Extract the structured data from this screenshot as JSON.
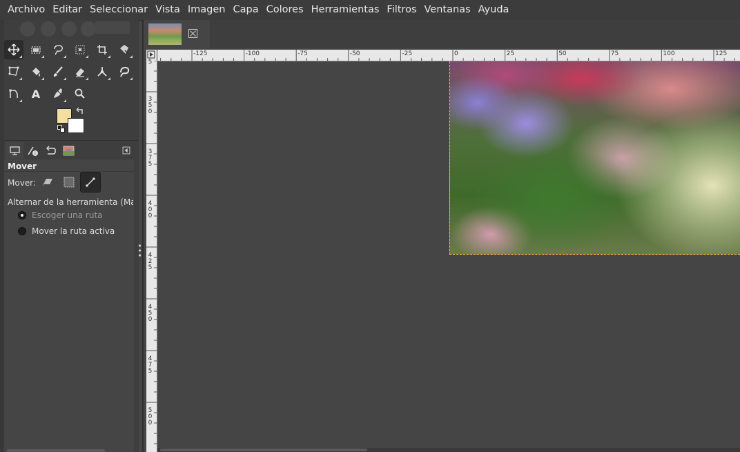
{
  "menu": [
    "Archivo",
    "Editar",
    "Seleccionar",
    "Vista",
    "Imagen",
    "Capa",
    "Colores",
    "Herramientas",
    "Filtros",
    "Ventanas",
    "Ayuda"
  ],
  "toolbox": {
    "tools": [
      {
        "name": "move-tool",
        "active": true
      },
      {
        "name": "rect-select-tool"
      },
      {
        "name": "free-select-tool"
      },
      {
        "name": "fuzzy-select-tool"
      },
      {
        "name": "crop-tool"
      },
      {
        "name": "unified-transform-tool"
      },
      {
        "name": "warp-transform-tool"
      },
      {
        "name": "bucket-fill-tool"
      },
      {
        "name": "paintbrush-tool"
      },
      {
        "name": "eraser-tool"
      },
      {
        "name": "clone-tool"
      },
      {
        "name": "smudge-tool"
      },
      {
        "name": "paths-tool"
      },
      {
        "name": "text-tool"
      },
      {
        "name": "color-picker-tool"
      },
      {
        "name": "zoom-tool"
      }
    ],
    "fg_color": "#f5dfa0",
    "bg_color": "#ffffff",
    "text_tool_glyph": "A"
  },
  "tool_options": {
    "title": "Mover",
    "mover_label": "Mover:",
    "toggle_label": "Alternar de la herramienta  (Mayús)",
    "radio": [
      {
        "label": "Escoger una ruta",
        "checked": true
      },
      {
        "label": "Mover la ruta activa",
        "checked": false
      }
    ]
  },
  "ruler_top_labels": [
    "-125",
    "-100",
    "-75",
    "-50",
    "-25",
    "0",
    "25",
    "50",
    "75",
    "100",
    "125"
  ],
  "ruler_left_labels": [
    "5",
    "350",
    "375",
    "400",
    "425",
    "450",
    "475",
    "500"
  ]
}
